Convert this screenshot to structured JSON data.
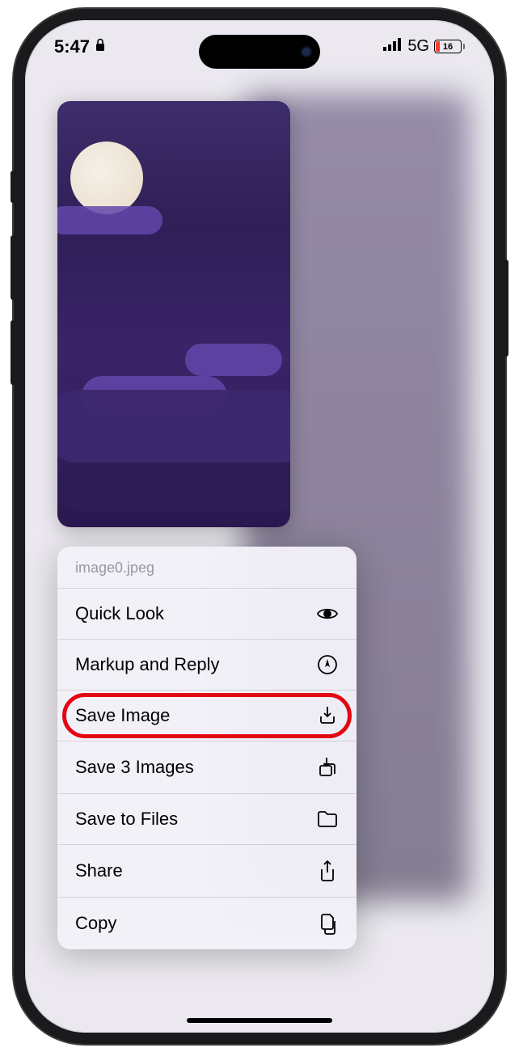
{
  "status_bar": {
    "time": "5:47",
    "lock_icon": "lock-icon",
    "signal_icon": "signal-icon",
    "network_label": "5G",
    "battery_level": "16"
  },
  "preview": {
    "header_filename": "image0.jpeg"
  },
  "menu": {
    "items": [
      {
        "label": "Quick Look",
        "icon": "eye-icon"
      },
      {
        "label": "Markup and Reply",
        "icon": "markup-icon"
      },
      {
        "label": "Save Image",
        "icon": "download-icon",
        "highlighted": true
      },
      {
        "label": "Save 3 Images",
        "icon": "download-multi-icon"
      },
      {
        "label": "Save to Files",
        "icon": "folder-icon"
      },
      {
        "label": "Share",
        "icon": "share-icon"
      },
      {
        "label": "Copy",
        "icon": "copy-icon"
      }
    ]
  }
}
